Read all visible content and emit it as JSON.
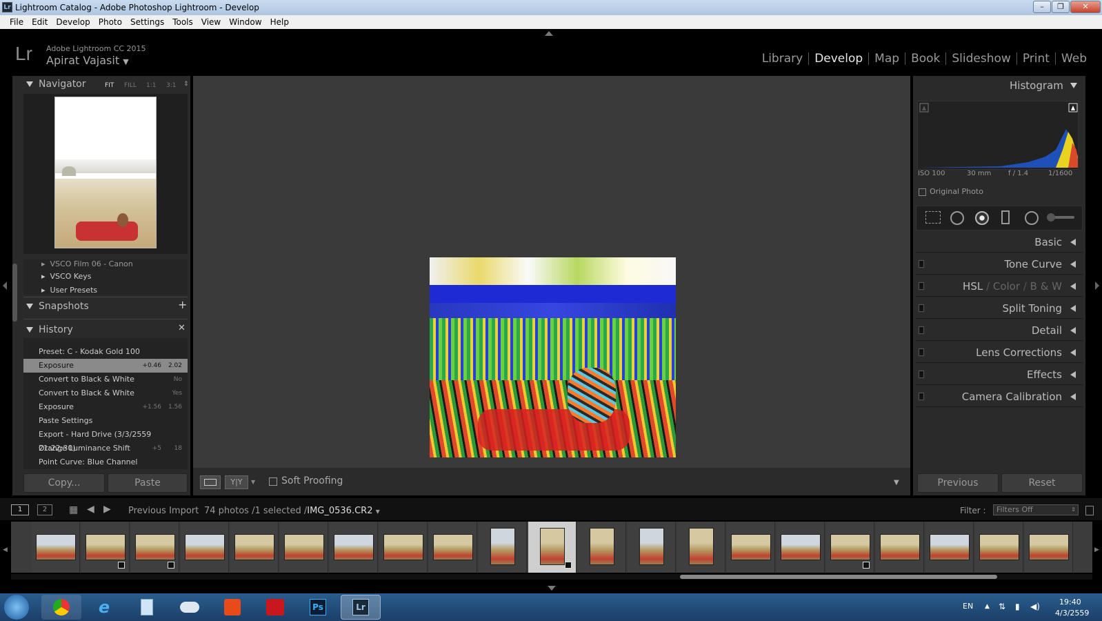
{
  "window": {
    "app_icon": "Lr",
    "title": "Lightroom Catalog - Adobe Photoshop Lightroom - Develop",
    "minimize": "–",
    "maximize": "❐",
    "close": "✕"
  },
  "menu": [
    "File",
    "Edit",
    "Develop",
    "Photo",
    "Settings",
    "Tools",
    "View",
    "Window",
    "Help"
  ],
  "identity": {
    "logo": "Lr",
    "version": "Adobe Lightroom CC 2015",
    "user": "Apirat Vajasit"
  },
  "modules": [
    {
      "label": "Library",
      "active": false
    },
    {
      "label": "Develop",
      "active": true
    },
    {
      "label": "Map",
      "active": false
    },
    {
      "label": "Book",
      "active": false
    },
    {
      "label": "Slideshow",
      "active": false
    },
    {
      "label": "Print",
      "active": false
    },
    {
      "label": "Web",
      "active": false
    }
  ],
  "navigator": {
    "title": "Navigator",
    "fit": "FIT",
    "fill": "FILL",
    "one": "1:1",
    "three": "3:1"
  },
  "presets": [
    "VSCO Film 06 - Canon",
    "VSCO Keys",
    "User Presets"
  ],
  "snapshots": {
    "title": "Snapshots"
  },
  "history": {
    "title": "History",
    "items": [
      {
        "label": "Preset: C - Kodak Gold 100",
        "v1": "",
        "v2": ""
      },
      {
        "label": "Exposure",
        "v1": "+0.46",
        "v2": "2.02",
        "selected": true
      },
      {
        "label": "Convert to Black & White",
        "v1": "",
        "v2": "No"
      },
      {
        "label": "Convert to Black & White",
        "v1": "",
        "v2": "Yes"
      },
      {
        "label": "Exposure",
        "v1": "+1.56",
        "v2": "1.56"
      },
      {
        "label": "Paste Settings",
        "v1": "",
        "v2": ""
      },
      {
        "label": "Export - Hard Drive (3/3/2559 21:22:30)",
        "v1": "",
        "v2": ""
      },
      {
        "label": "Orange Luminance Shift",
        "v1": "+5",
        "v2": "18"
      },
      {
        "label": "Point Curve: Blue Channel",
        "v1": "",
        "v2": ""
      }
    ]
  },
  "left_buttons": {
    "copy": "Copy...",
    "paste": "Paste"
  },
  "toolbar": {
    "soft_proofing": "Soft Proofing",
    "compare": "Y|Y"
  },
  "histogram": {
    "title": "Histogram",
    "iso": "ISO 100",
    "focal": "30 mm",
    "aperture": "f / 1.4",
    "shutter": "1/1600",
    "original": "Original Photo"
  },
  "panels": [
    {
      "label": "Basic",
      "switch": false
    },
    {
      "label": "Tone Curve",
      "switch": true
    },
    {
      "label": "HSL",
      "switch": true
    },
    {
      "label": "Split Toning",
      "switch": true
    },
    {
      "label": "Detail",
      "switch": true
    },
    {
      "label": "Lens Corrections",
      "switch": true
    },
    {
      "label": "Effects",
      "switch": true
    },
    {
      "label": "Camera Calibration",
      "switch": true
    }
  ],
  "hsl": {
    "hsl": "HSL",
    "color": "Color",
    "bw": "B & W",
    "sep": "/"
  },
  "right_buttons": {
    "previous": "Previous",
    "reset": "Reset"
  },
  "filmbar": {
    "screen1": "1",
    "screen2": "2",
    "source": "Previous Import",
    "count": "74 photos /1 selected /",
    "filename": "IMG_0536.CR2",
    "filter_label": "Filter :",
    "filter_value": "Filters Off"
  },
  "taskbar": {
    "lang": "EN",
    "time": "19:40",
    "date": "4/3/2559",
    "ps": "Ps",
    "lr": "Lr"
  },
  "colors": {
    "accent": "#e8e8e8",
    "panel": "#2a2a2a",
    "canvas": "#3a3a3a"
  }
}
